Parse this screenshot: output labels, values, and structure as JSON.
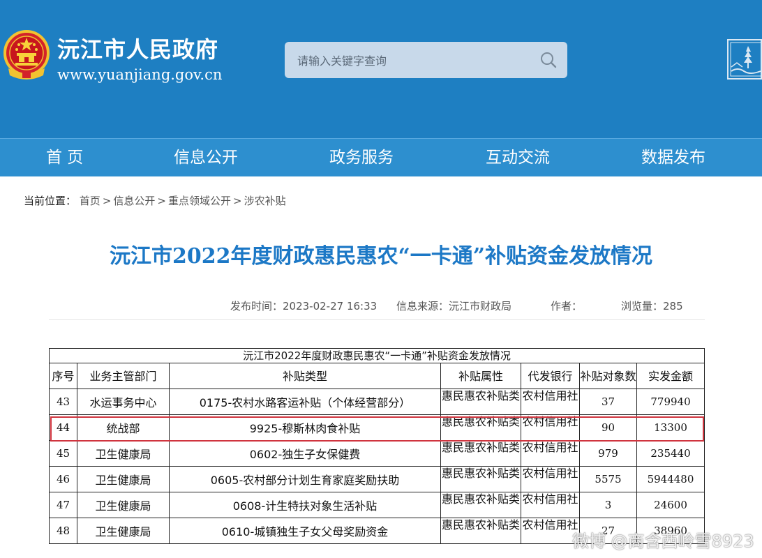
{
  "site": {
    "name": "沅江市人民政府",
    "url": "www.yuanjiang.gov.cn",
    "search_placeholder": "请输入关键字查询"
  },
  "nav": [
    "首 页",
    "信息公开",
    "政务服务",
    "互动交流",
    "数据发布"
  ],
  "breadcrumb": {
    "prefix": "当前位置：",
    "items": [
      "首页",
      "信息公开",
      "重点领域公开",
      "涉农补贴"
    ],
    "separator": ">"
  },
  "article": {
    "title": "沅江市2022年度财政惠民惠农“一卡通”补贴资金发放情况",
    "publish_time": "发布时间：2023-02-27 16:33",
    "source": "信息来源：沅江市财政局",
    "author": "作者：",
    "views": "浏览量：285"
  },
  "table": {
    "caption": "沅江市2022年度财政惠民惠农“一卡通”补贴资金发放情况",
    "headers": [
      "序号",
      "业务主管部门",
      "补贴类型",
      "补贴属性",
      "代发银行",
      "补贴对象数",
      "实发金额"
    ],
    "rows": [
      [
        "43",
        "水运事务中心",
        "0175-农村水路客运补贴（个体经营部分）",
        "惠民惠农补贴类",
        "农村信用社",
        "37",
        "779940"
      ],
      [
        "44",
        "统战部",
        "9925-穆斯林肉食补贴",
        "惠民惠农补贴类",
        "农村信用社",
        "90",
        "13300"
      ],
      [
        "45",
        "卫生健康局",
        "0602-独生子女保健费",
        "惠民惠农补贴类",
        "农村信用社",
        "979",
        "235440"
      ],
      [
        "46",
        "卫生健康局",
        "0605-农村部分计划生育家庭奖励扶助",
        "惠民惠农补贴类",
        "农村信用社",
        "5575",
        "5944480"
      ],
      [
        "47",
        "卫生健康局",
        "0608-计生特扶对象生活补贴",
        "惠民惠农补贴类",
        "农村信用社",
        "3",
        "24600"
      ],
      [
        "48",
        "卫生健康局",
        "0610-城镇独生子女父母奖励资金",
        "惠民惠农补贴类",
        "农村信用社",
        "27",
        "38960"
      ]
    ]
  },
  "watermark": "微博 @商含西岭雪8923",
  "colors": {
    "header_bg": "#1e7fc2",
    "nav_bg": "#2d8fcf",
    "title": "#1c78c6",
    "highlight": "#d0343e"
  }
}
